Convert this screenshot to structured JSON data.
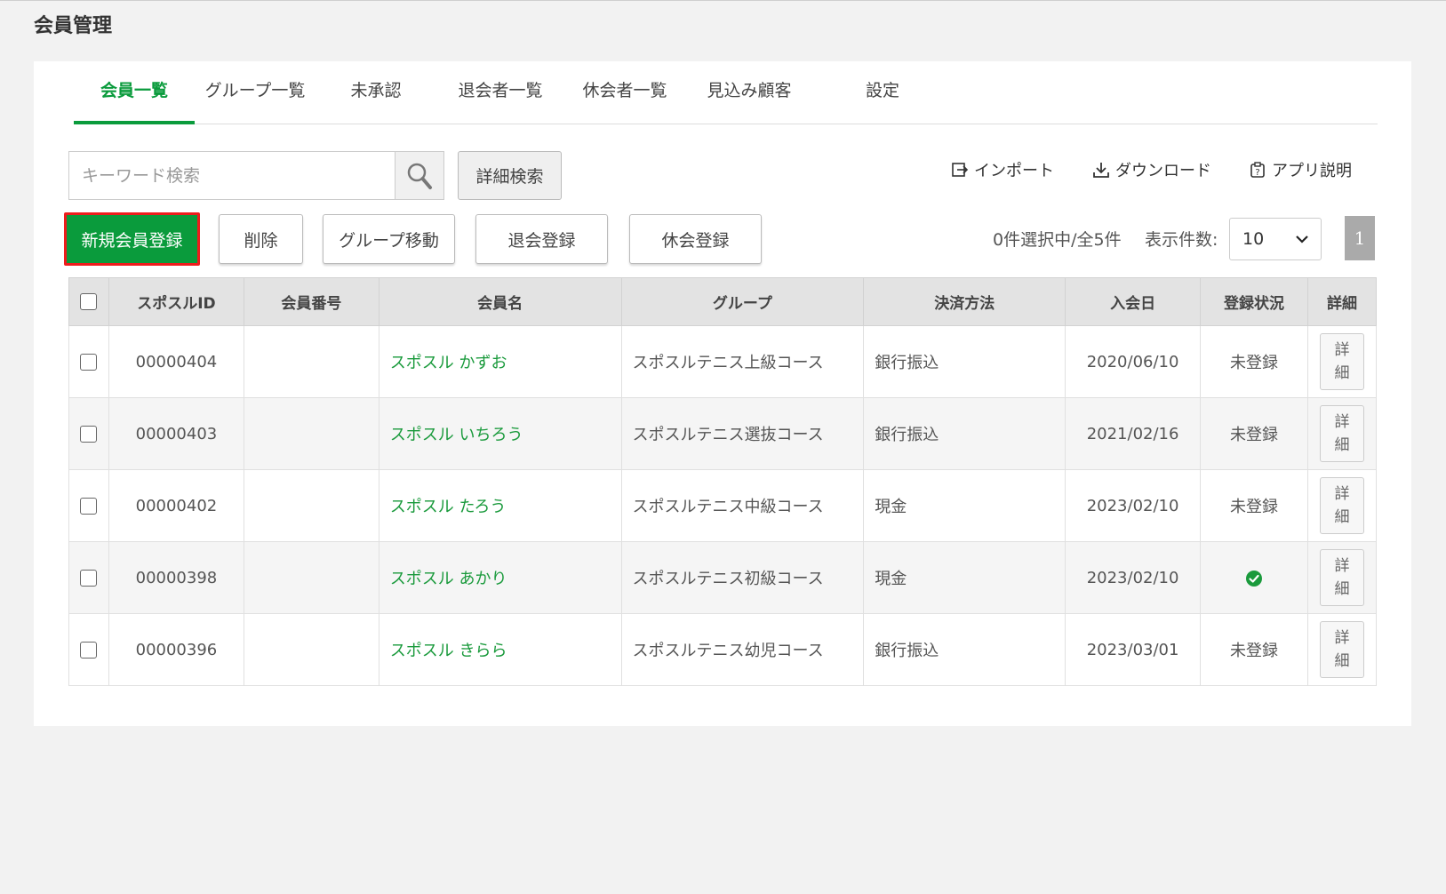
{
  "page": {
    "title": "会員管理"
  },
  "tabs": [
    {
      "label": "会員一覧",
      "active": true
    },
    {
      "label": "グループ一覧"
    },
    {
      "label": "未承認"
    },
    {
      "label": "退会者一覧"
    },
    {
      "label": "休会者一覧"
    },
    {
      "label": "見込み顧客"
    },
    {
      "label": "設定"
    }
  ],
  "search": {
    "placeholder": "キーワード検索",
    "detail_label": "詳細検索"
  },
  "toolbar": {
    "import_label": "インポート",
    "download_label": "ダウンロード",
    "help_label": "アプリ説明"
  },
  "actions": {
    "new_member": "新規会員登録",
    "delete": "削除",
    "group_move": "グループ移動",
    "withdraw": "退会登録",
    "suspend": "休会登録"
  },
  "selection": {
    "status": "0件選択中/全5件",
    "per_page_label": "表示件数:",
    "per_page_value": "10",
    "current_page": "1"
  },
  "table": {
    "columns": [
      "スポスルID",
      "会員番号",
      "会員名",
      "グループ",
      "決済方法",
      "入会日",
      "登録状況",
      "詳細"
    ],
    "detail_label_1": "詳",
    "detail_label_2": "細",
    "rows": [
      {
        "id": "00000404",
        "number": "",
        "name": "スポスル かずお",
        "group": "スポスルテニス上級コース",
        "payment": "銀行振込",
        "joined": "2020/06/10",
        "status": "未登録",
        "registered": false
      },
      {
        "id": "00000403",
        "number": "",
        "name": "スポスル いちろう",
        "group": "スポスルテニス選抜コース",
        "payment": "銀行振込",
        "joined": "2021/02/16",
        "status": "未登録",
        "registered": false
      },
      {
        "id": "00000402",
        "number": "",
        "name": "スポスル たろう",
        "group": "スポスルテニス中級コース",
        "payment": "現金",
        "joined": "2023/02/10",
        "status": "未登録",
        "registered": false
      },
      {
        "id": "00000398",
        "number": "",
        "name": "スポスル あかり",
        "group": "スポスルテニス初級コース",
        "payment": "現金",
        "joined": "2023/02/10",
        "status": "",
        "registered": true
      },
      {
        "id": "00000396",
        "number": "",
        "name": "スポスル きらら",
        "group": "スポスルテニス幼児コース",
        "payment": "銀行振込",
        "joined": "2023/03/01",
        "status": "未登録",
        "registered": false
      }
    ]
  },
  "colors": {
    "accent": "#0a9b3c",
    "highlight_border": "#ee1c1c",
    "link": "#1a9a3c"
  }
}
